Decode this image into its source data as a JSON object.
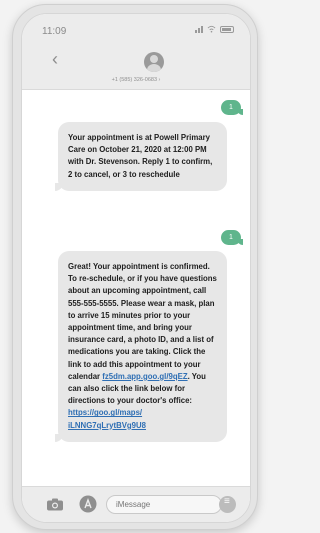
{
  "status_bar": {
    "time": "11:09"
  },
  "contact": {
    "phone": "+1 (585) 326-0683 ›"
  },
  "messages": [
    {
      "type": "outgoing",
      "text": "1"
    },
    {
      "type": "incoming",
      "text": "Your appointment is at Powell Primary Care on October 21, 2020 at 12:00 PM with Dr. Stevenson. Reply 1 to confirm, 2 to cancel, or 3 to reschedule"
    },
    {
      "type": "outgoing",
      "text": "1"
    },
    {
      "type": "incoming",
      "text_1": "Great! Your appointment is confirmed. To re-schedule, or if you have questions about an upcoming appointment, call 555-555-5555. Please wear a mask, plan to arrive 15 minutes prior to your appointment time, and bring your insurance card, a photo ID, and a list of medications you are taking. Click the link to add this appointment to your calendar ",
      "link_1": "fz5dm.app.goo.gl/9qEZ",
      "text_2": ". You can also click the link below for directions to your doctor's office: ",
      "link_2": "https://goo.gl/maps/ iLNNG7qLrytBVg9U8"
    }
  ],
  "composer": {
    "placeholder": "iMessage"
  },
  "icons": {
    "back": "chevron-left-icon",
    "avatar": "person-icon",
    "camera": "camera-icon",
    "apps": "app-store-icon",
    "audio": "audio-icon"
  },
  "colors": {
    "reply_bubble": "#5fb58c",
    "incoming_bubble": "#e7e7e7",
    "link": "#2f6fb4"
  }
}
